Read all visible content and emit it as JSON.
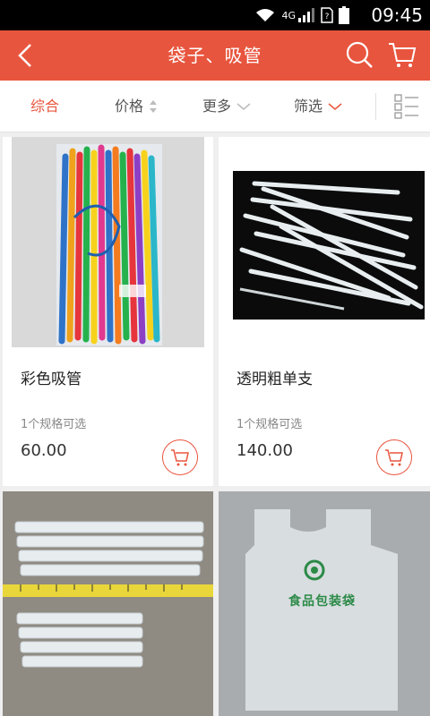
{
  "status_bar": {
    "network": "4G",
    "time": "09:45"
  },
  "header": {
    "title": "袋子、吸管"
  },
  "filters": [
    {
      "label": "综合"
    },
    {
      "label": "价格"
    },
    {
      "label": "更多"
    },
    {
      "label": "筛选"
    }
  ],
  "products": [
    {
      "name": "彩色吸管",
      "spec": "1个规格可选",
      "price": "60.00"
    },
    {
      "name": "透明粗单支",
      "spec": "1个规格可选",
      "price": "140.00"
    },
    {
      "name": "",
      "spec": "",
      "price": ""
    },
    {
      "name": "",
      "spec": "",
      "price": ""
    }
  ],
  "bag_print": "食品包装袋",
  "colors": {
    "accent": "#e8553e",
    "background": "#efefef"
  }
}
